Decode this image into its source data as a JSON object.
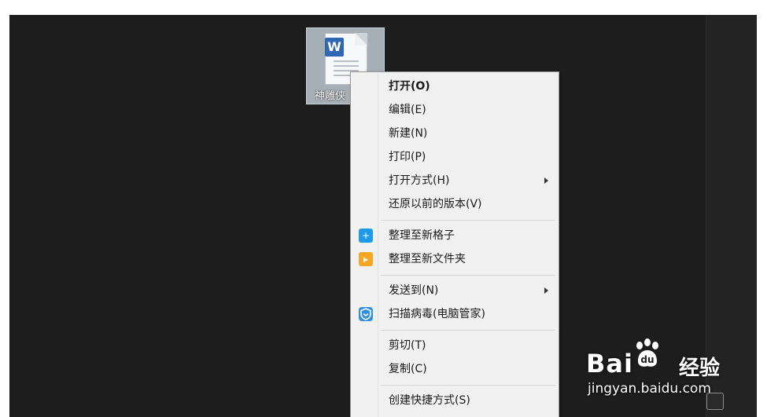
{
  "desktop_file": {
    "label": "神雕侠",
    "badge": "W",
    "icon": "wps-document-icon"
  },
  "context_menu": {
    "items": [
      {
        "label": "打开(O)",
        "bold": true
      },
      {
        "label": "编辑(E)"
      },
      {
        "label": "新建(N)"
      },
      {
        "label": "打印(P)"
      },
      {
        "label": "打开方式(H)",
        "submenu": true
      },
      {
        "label": "还原以前的版本(V)"
      },
      {
        "label": "整理至新格子",
        "icon": "fences-new-grid-icon",
        "icon_color": "#1e9be8"
      },
      {
        "label": "整理至新文件夹",
        "icon": "fences-new-folder-icon",
        "icon_color": "#f5a623"
      },
      {
        "label": "发送到(N)",
        "submenu": true
      },
      {
        "label": "扫描病毒(电脑管家)",
        "icon": "pc-manager-shield-icon",
        "icon_color": "#2f8fe0"
      },
      {
        "label": "剪切(T)"
      },
      {
        "label": "复制(C)"
      },
      {
        "label": "创建快捷方式(S)"
      }
    ]
  },
  "watermark": {
    "brand": "Bai",
    "brand_suffix": "经验",
    "url": "jingyan.baidu.com",
    "logo_icon": "baidu-paw-icon"
  },
  "colors": {
    "desktop": "#1d1d1e",
    "menu_bg": "#f1f1f1",
    "file_badge": "#2f67b5"
  }
}
